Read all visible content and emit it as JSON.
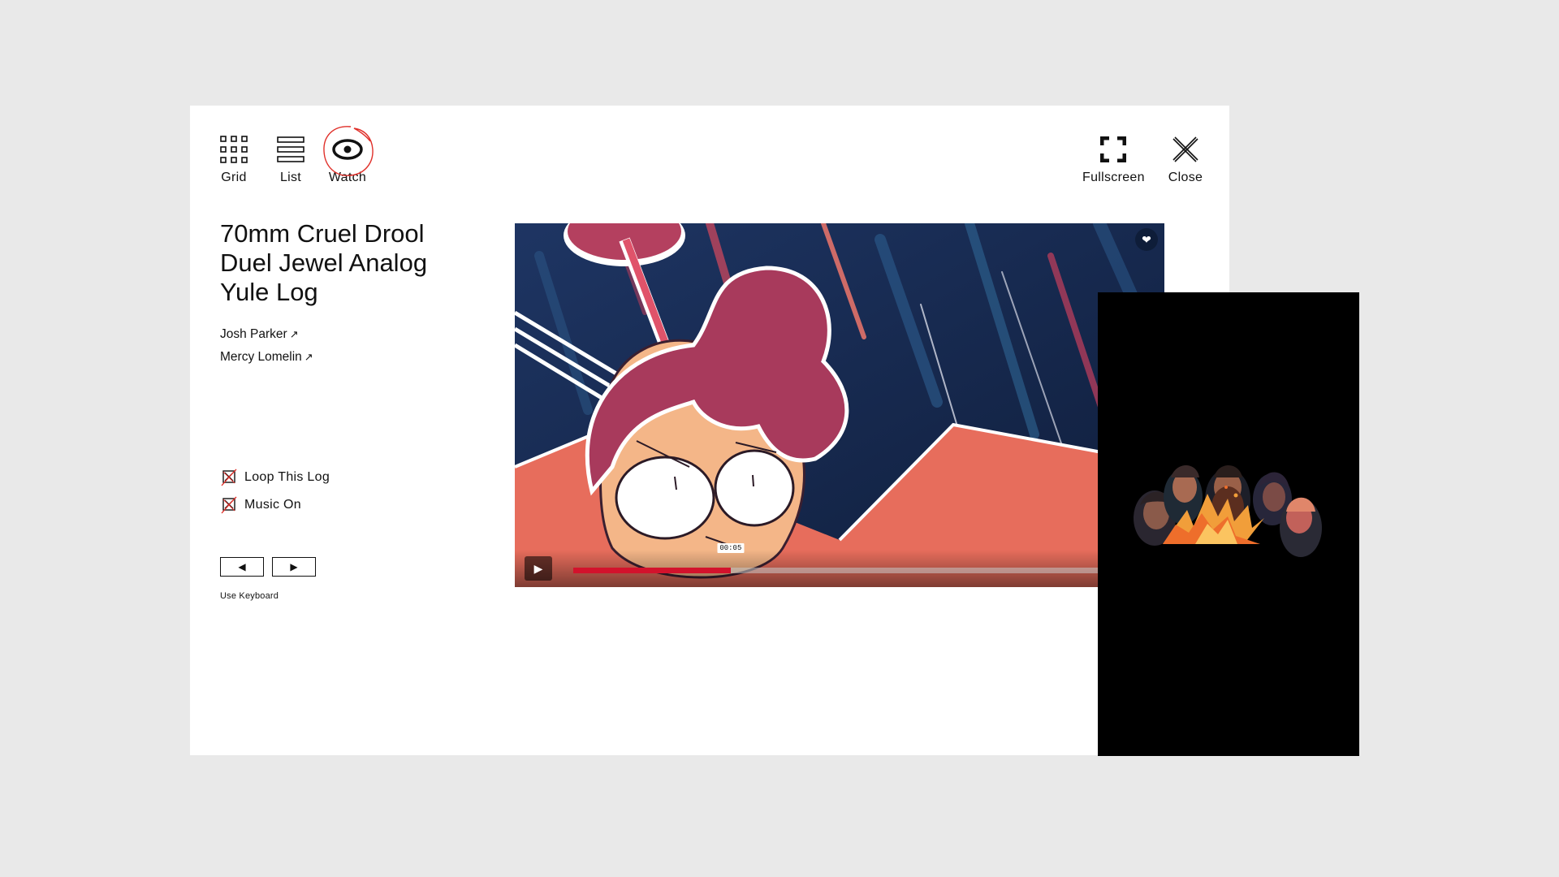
{
  "nav": {
    "grid": "Grid",
    "list": "List",
    "watch": "Watch",
    "fullscreen": "Fullscreen",
    "close": "Close"
  },
  "title": "70mm Cruel Drool Duel Jewel Analog Yule Log",
  "credits": [
    {
      "name": "Josh Parker",
      "icon": "external-arrow-icon"
    },
    {
      "name": "Mercy Lomelin",
      "icon": "external-arrow-icon"
    }
  ],
  "toggles": {
    "loop": "Loop This Log",
    "music": "Music On"
  },
  "controls": {
    "prev_symbol": "◀",
    "next_symbol": "▶",
    "keyboard_note": "Use Keyboard"
  },
  "player": {
    "time": "00:05",
    "progress": 0.27,
    "play_symbol": "▶",
    "heart_symbol": "❤"
  },
  "colors": {
    "page_bg": "#e9e9e9",
    "progress": "#d3122c",
    "annotation_red": "#e0302a"
  }
}
